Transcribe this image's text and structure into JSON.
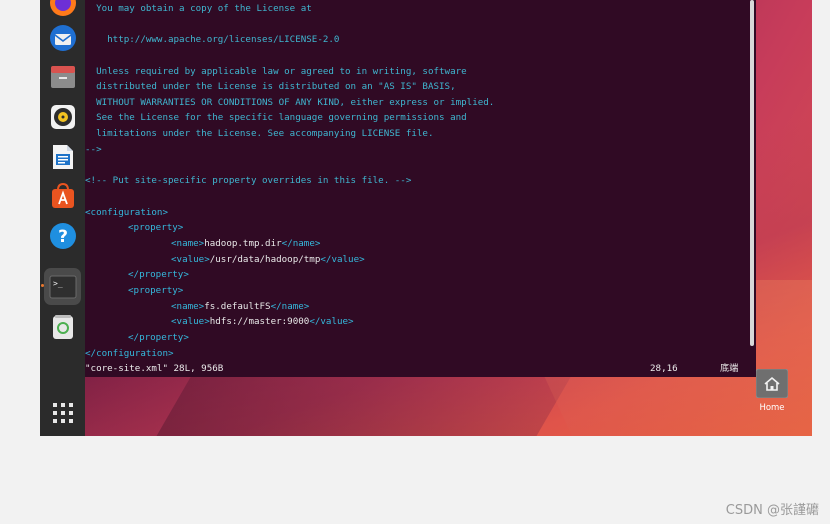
{
  "dock": {
    "items": [
      {
        "name": "firefox"
      },
      {
        "name": "thunderbird"
      },
      {
        "name": "files"
      },
      {
        "name": "rhythmbox"
      },
      {
        "name": "libreoffice-writer"
      },
      {
        "name": "app-center"
      },
      {
        "name": "help"
      },
      {
        "name": "terminal"
      },
      {
        "name": "trash"
      },
      {
        "name": "show-apps"
      }
    ],
    "help_glyph": "?",
    "terminal_glyph": ">_"
  },
  "editor": {
    "lines": [
      "  You may obtain a copy of the License at",
      "",
      "    http://www.apache.org/licenses/LICENSE-2.0",
      "",
      "  Unless required by applicable law or agreed to in writing, software",
      "  distributed under the License is distributed on an \"AS IS\" BASIS,",
      "  WITHOUT WARRANTIES OR CONDITIONS OF ANY KIND, either express or implied.",
      "  See the License for the specific language governing permissions and",
      "  limitations under the License. See accompanying LICENSE file.",
      "-->",
      "",
      "<!-- Put site-specific property overrides in this file. -->",
      ""
    ],
    "xml": {
      "config_open": "<configuration>",
      "prop_open": "<property>",
      "prop_close": "</property>",
      "name_open": "<name>",
      "name_close": "</name>",
      "value_open": "<value>",
      "value_close": "</value>",
      "config_close": "</configuration>",
      "prop1_name": "hadoop.tmp.dir",
      "prop1_value": "/usr/data/hadoop/tmp",
      "prop2_name": "fs.defaultFS",
      "prop2_value": "hdfs://master:9000"
    },
    "status": {
      "file_info": "\"core-site.xml\" 28L, 956B",
      "position": "28,16",
      "scroll": "底端"
    }
  },
  "desktop": {
    "home_label": "Home"
  },
  "watermark": "CSDN @张謹礳"
}
